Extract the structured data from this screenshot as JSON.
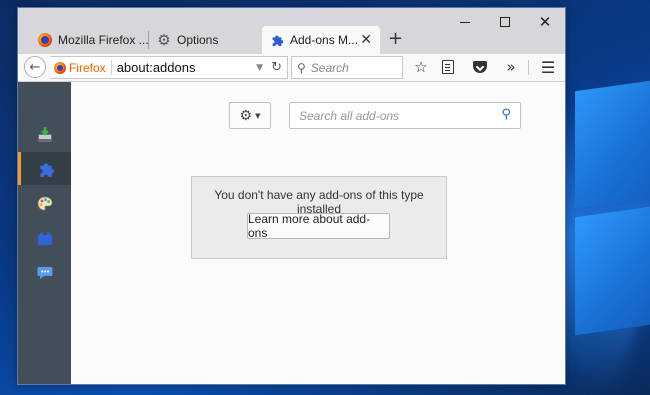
{
  "browser": {
    "tabs": [
      {
        "label": "Mozilla Firefox ...",
        "icon": "firefox-icon"
      },
      {
        "label": "Options",
        "icon": "gear-icon"
      },
      {
        "label": "Add-ons M...",
        "icon": "puzzle-icon",
        "active": true
      }
    ],
    "window_controls": {
      "minimize": "minimize-icon",
      "maximize": "maximize-icon",
      "close": "✕"
    },
    "new_tab": "+",
    "identity_label": "Firefox",
    "url": "about:addons",
    "search_placeholder": "Search"
  },
  "addons": {
    "sidebar": [
      {
        "name": "get-addons",
        "icon": "download-tray-icon"
      },
      {
        "name": "extensions",
        "icon": "puzzle-icon",
        "active": true
      },
      {
        "name": "appearance",
        "icon": "palette-icon"
      },
      {
        "name": "plugins",
        "icon": "plugin-block-icon"
      },
      {
        "name": "services",
        "icon": "speech-bubble-icon"
      }
    ],
    "search_placeholder": "Search all add-ons",
    "empty_message": "You don't have any add-ons of this type installed",
    "learn_more_label": "Learn more about add-ons"
  },
  "colors": {
    "sidebar_bg": "#424f5a",
    "active_marker": "#f19b34",
    "identity_orange": "#e66000",
    "desktop_blue": "#0a3a86"
  }
}
